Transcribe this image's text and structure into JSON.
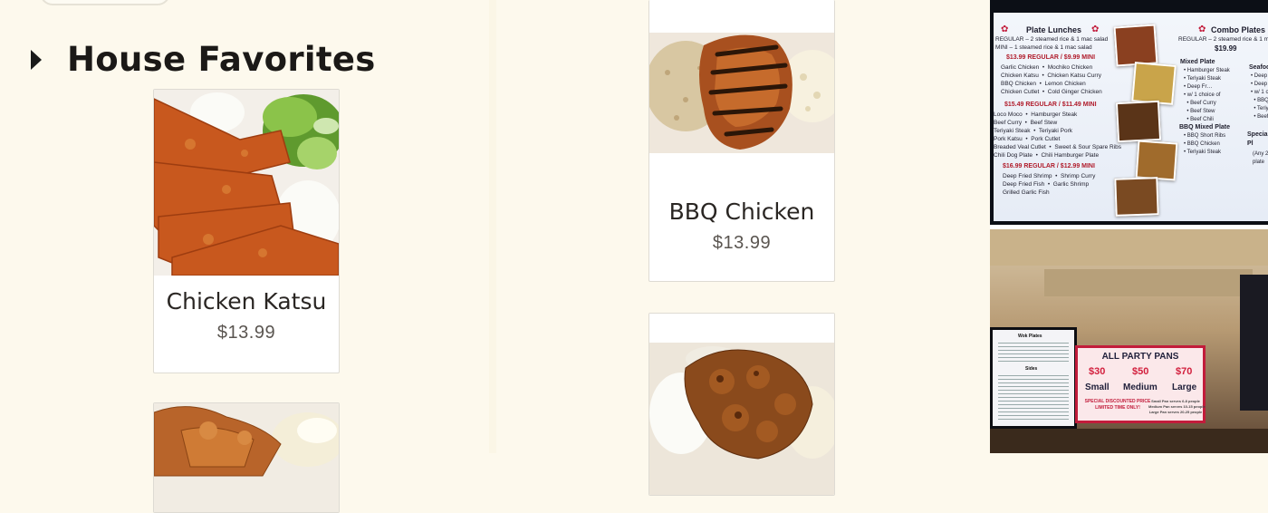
{
  "section": {
    "title": "House Favorites"
  },
  "cards": [
    {
      "name": "Chicken Katsu",
      "price": "$13.99",
      "image": "chicken-katsu-plate"
    },
    {
      "name": "BBQ Chicken",
      "price": "$13.99",
      "image": "bbq-chicken-plate"
    },
    {
      "name": "",
      "price": "",
      "image": "fried-chicken-plate"
    },
    {
      "name": "",
      "price": "",
      "image": "teriyaki-chicken-plate"
    }
  ],
  "menu_board": {
    "plate_lunches_title": "Plate Lunches",
    "plate_lunches_desc": "REGULAR – 2 steamed rice & 1 mac salad\nMINI – 1 steamed rice & 1 mac salad",
    "price_tier_1": "$13.99 REGULAR / $9.99 MINI",
    "tier_1_items": "Garlic Chicken  •  Mochiko Chicken\nChicken Katsu  •  Chicken Katsu Curry\nBBQ Chicken  •  Lemon Chicken\nChicken Cutlet  •  Cold Ginger Chicken",
    "price_tier_2": "$15.49 REGULAR / $11.49 MINI",
    "tier_2_items": "Loco Moco  •  Hamburger Steak\nBeef Curry  •  Beef Stew\nTeriyaki Steak  •  Teriyaki Pork\nPork Katsu  •  Pork Cutlet\nBreaded Veal Cutlet  •  Sweet & Sour Spare Ribs\nChili Dog Plate  •  Chili Hamburger Plate",
    "price_tier_3": "$16.99 REGULAR / $12.99 MINI",
    "tier_3_items": "Deep Fried Shrimp  •  Shrimp Curry\nDeep Fried Fish  •  Garlic Shrimp\nGrilled Garlic Fish",
    "combo_title": "Combo Plates",
    "combo_desc": "REGULAR – 2 steamed rice & 1 mac",
    "combo_price": "$19.99",
    "mixed_plate_title": "Mixed Plate",
    "mixed_plate_items": "• Hamburger Steak\n• Teriyaki Steak\n• Deep Fr…\n• w/ 1 choice of\n  • Beef Curry\n  • Beef Stew\n  • Beef Chili",
    "bbq_mixed_title": "BBQ Mixed Plate",
    "bbq_mixed_items": "• BBQ Short Ribs\n• BBQ Chicken\n• Teriyaki Steak",
    "seafood_title": "Seafoo",
    "seafood_items": "• Deep F\n• Deep F\n• w/ 1 ch\n  • BBQ\n  • Teriy\n  • Beef",
    "special_title": "Special\nPl",
    "special_note": "(Any 2 c\nplate"
  },
  "shop_photo": {
    "wok_title": "Wok Plates",
    "sides_title": "Sides",
    "party_title": "ALL PARTY PANS",
    "party_prices": [
      "$30",
      "$50",
      "$70"
    ],
    "party_sizes": [
      "Small",
      "Medium",
      "Large"
    ],
    "party_note_1": "SPECIAL DISCOUNTED PRICE\nLIMITED TIME ONLY!",
    "party_note_2": "Small Pan serves 6-8 people\nMedium Pan serves 10-15 people\nLarge Pan serves 20-25 people"
  },
  "colors": {
    "background": "#fdf9ed",
    "card_border": "#dedbd3",
    "text_dark": "#1b1917",
    "price_gray": "#5a5550",
    "accent_red": "#c21c3b"
  }
}
